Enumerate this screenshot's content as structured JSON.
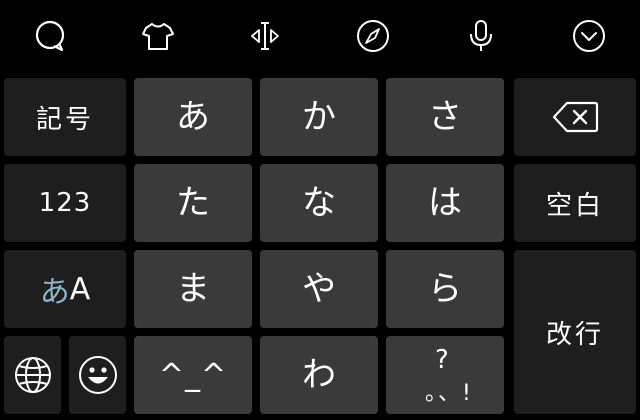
{
  "toolbar": {
    "icons": [
      "chat-bubble-icon",
      "tshirt-icon",
      "cursor-move-icon",
      "compass-icon",
      "microphone-icon",
      "chevron-down-circle-icon"
    ]
  },
  "keys": {
    "kigo": "記号",
    "numbers": "123",
    "mode_kana": "あ",
    "mode_alpha": "A",
    "a": "あ",
    "ka": "か",
    "sa": "さ",
    "ta": "た",
    "na": "な",
    "ha": "は",
    "ma": "ま",
    "ya": "や",
    "ra": "ら",
    "emoticon": "^_^",
    "wa": "わ",
    "punct_top": "?",
    "punct_bottom": "。、!",
    "space": "空白",
    "enter": "改行"
  },
  "colors": {
    "background": "#000000",
    "main_key": "#3a3a3a",
    "function_key": "#1e1e1e",
    "text": "#ffffff",
    "kana_mode_accent": "#8fb3cc"
  }
}
